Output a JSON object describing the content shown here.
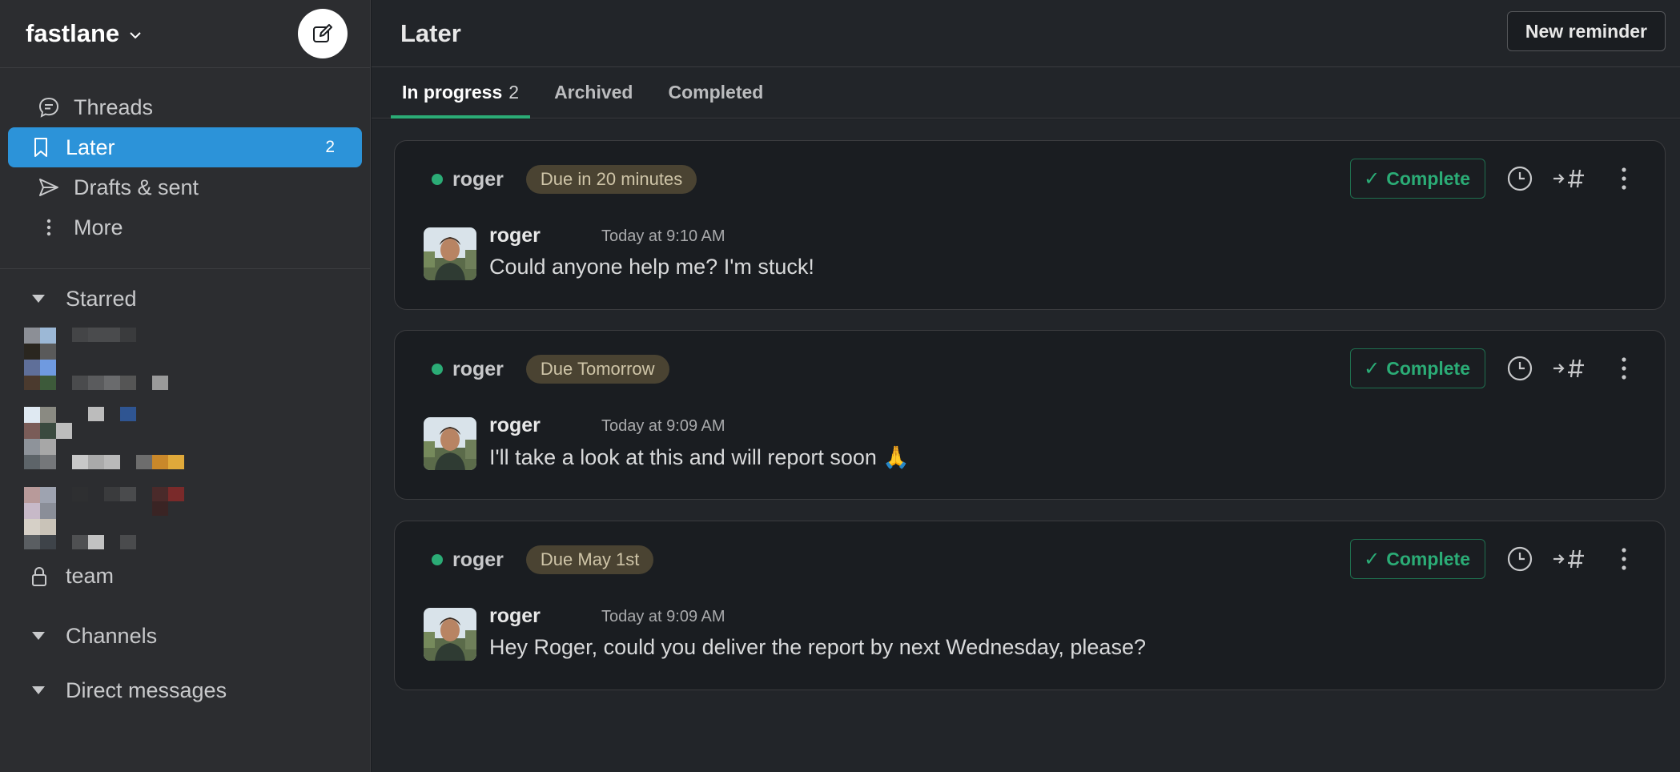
{
  "workspace": {
    "name": "fastlane"
  },
  "sidebar": {
    "nav": [
      {
        "label": "Threads",
        "icon": "threads-icon"
      },
      {
        "label": "Later",
        "icon": "bookmark-icon",
        "count": "2",
        "active": true
      },
      {
        "label": "Drafts & sent",
        "icon": "send-icon"
      },
      {
        "label": "More",
        "icon": "more-vertical-icon"
      }
    ],
    "starred_label": "Starred",
    "team_label": "team",
    "channels_label": "Channels",
    "dms_label": "Direct messages"
  },
  "header": {
    "title": "Later",
    "new_reminder_label": "New reminder"
  },
  "tabs": [
    {
      "label": "In progress",
      "count": "2",
      "active": true
    },
    {
      "label": "Archived"
    },
    {
      "label": "Completed"
    }
  ],
  "colors": {
    "accent": "#2c93d9",
    "success": "#2bac76",
    "badge_bg": "#4a4332"
  },
  "reminders": [
    {
      "user": "roger",
      "due": "Due in 20 minutes",
      "complete_label": "Complete",
      "author": "roger",
      "time": "Today at 9:10 AM",
      "text": "Could anyone help me? I'm stuck!"
    },
    {
      "user": "roger",
      "due": "Due Tomorrow",
      "complete_label": "Complete",
      "author": "roger",
      "time": "Today at 9:09 AM",
      "text": "I'll take a look at this and will report soon 🙏"
    },
    {
      "user": "roger",
      "due": "Due May 1st",
      "complete_label": "Complete",
      "author": "roger",
      "time": "Today at 9:09 AM",
      "text": "Hey Roger, could you deliver the report by next Wednesday, please?"
    }
  ]
}
